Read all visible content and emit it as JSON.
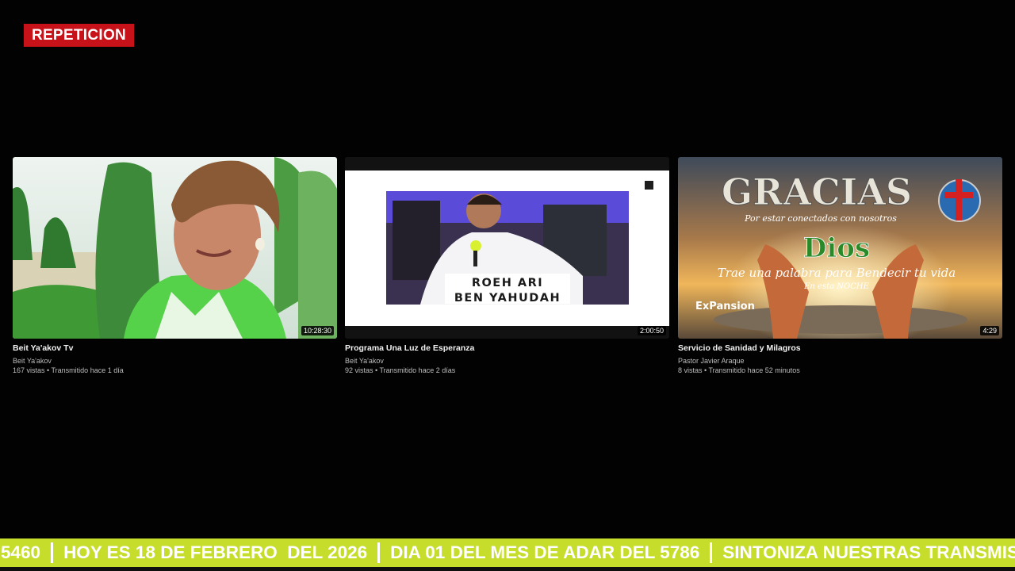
{
  "badge": {
    "label": "REPETICION",
    "color": "#c8121a"
  },
  "videos": [
    {
      "title": "Beit Ya'akov Tv",
      "channel": "Beit Ya'akov",
      "meta": "167 vistas • Transmitido hace 1 día",
      "duration": "10:28:30"
    },
    {
      "title": "Programa Una Luz de Esperanza",
      "channel": "Beit Ya'akov",
      "meta": "92 vistas • Transmitido hace 2 días",
      "duration": "2:00:50",
      "banner_line1": "ROEH ARI",
      "banner_line2": "BEN YAHUDAH"
    },
    {
      "title": "Servicio de Sanidad y Milagros",
      "channel": "Pastor Javier Araque",
      "meta": "8 vistas • Transmitido hace 52 minutos",
      "duration": "4:29",
      "poster_title": "GRACIAS",
      "poster_sub": "Por estar conectados con nosotros",
      "poster_word": "Dios",
      "poster_line": "Trae una palabra para Bendecir tu vida",
      "poster_small": "En esta NOCHE",
      "poster_brand": "ExPansion"
    }
  ],
  "ticker": {
    "color": "#c6dd2c",
    "segments": [
      "5460",
      "HOY ES 18 DE FEBRERO  DEL 2026",
      "DIA 01 DEL MES DE ADAR DEL 5786",
      "SINTONIZA NUESTRAS TRANSMIS"
    ]
  }
}
